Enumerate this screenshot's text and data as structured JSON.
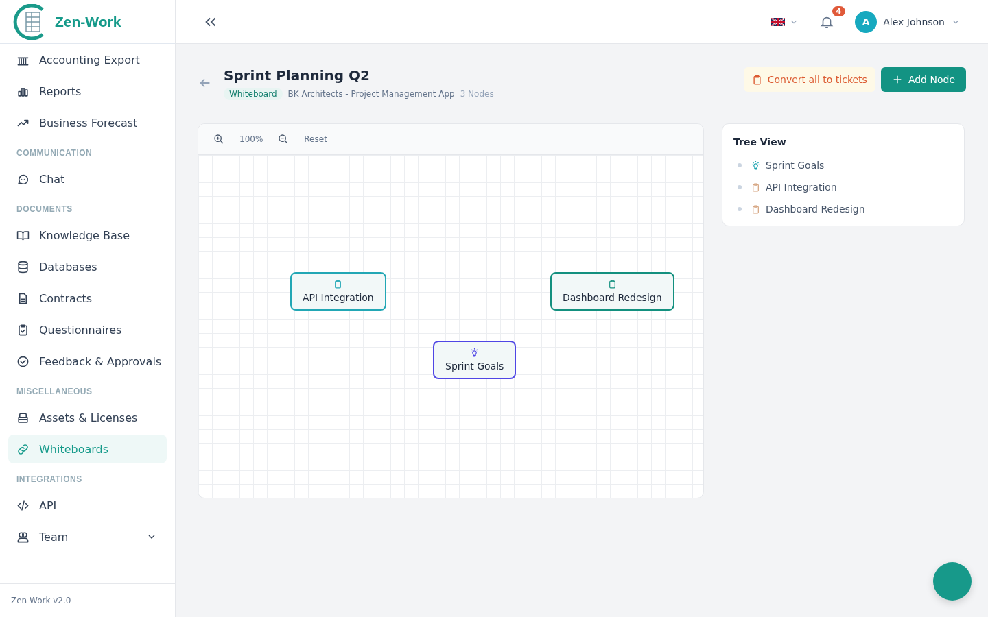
{
  "brand": {
    "name": "Zen-Work"
  },
  "sidebar": {
    "items": [
      {
        "kind": "item",
        "label": "Accounting Export",
        "selected": false
      },
      {
        "kind": "item",
        "label": "Reports",
        "selected": false
      },
      {
        "kind": "item",
        "label": "Business Forecast",
        "selected": false
      },
      {
        "kind": "section",
        "label": "COMMUNICATION"
      },
      {
        "kind": "item",
        "label": "Chat",
        "selected": false
      },
      {
        "kind": "section",
        "label": "DOCUMENTS"
      },
      {
        "kind": "item",
        "label": "Knowledge Base",
        "selected": false
      },
      {
        "kind": "item",
        "label": "Databases",
        "selected": false
      },
      {
        "kind": "item",
        "label": "Contracts",
        "selected": false
      },
      {
        "kind": "item",
        "label": "Questionnaires",
        "selected": false
      },
      {
        "kind": "item",
        "label": "Feedback & Approvals",
        "selected": false
      },
      {
        "kind": "section",
        "label": "MISCELLANEOUS"
      },
      {
        "kind": "item",
        "label": "Assets & Licenses",
        "selected": false
      },
      {
        "kind": "item",
        "label": "Whiteboards",
        "selected": true
      },
      {
        "kind": "section",
        "label": "INTEGRATIONS"
      },
      {
        "kind": "item",
        "label": "API",
        "selected": false
      },
      {
        "kind": "item",
        "label": "Team",
        "selected": false,
        "expandable": true
      }
    ],
    "version": "Zen-Work v2.0"
  },
  "topbar": {
    "notifications": "4",
    "user": {
      "initial": "A",
      "name": "Alex Johnson"
    }
  },
  "page": {
    "title": "Sprint Planning Q2",
    "tag": "Whiteboard",
    "project": "BK Architects - Project Management App",
    "count": "3 Nodes",
    "actions": [
      {
        "kind": "convert",
        "label": "Convert all to tickets"
      },
      {
        "kind": "add",
        "label": "Add Node"
      }
    ]
  },
  "canvas": {
    "zoom": "100%",
    "reset": "Reset",
    "nodes": [
      {
        "kind": "task",
        "label": "API Integration",
        "color": "#22a7b5"
      },
      {
        "kind": "task",
        "label": "Dashboard Redesign",
        "color": "#13907f"
      },
      {
        "kind": "idea",
        "label": "Sprint Goals",
        "color": "#4f46e5"
      }
    ]
  },
  "tree": {
    "title": "Tree View",
    "items": [
      {
        "kind": "idea",
        "label": "Sprint Goals"
      },
      {
        "kind": "task",
        "label": "API Integration"
      },
      {
        "kind": "task",
        "label": "Dashboard Redesign"
      }
    ]
  }
}
